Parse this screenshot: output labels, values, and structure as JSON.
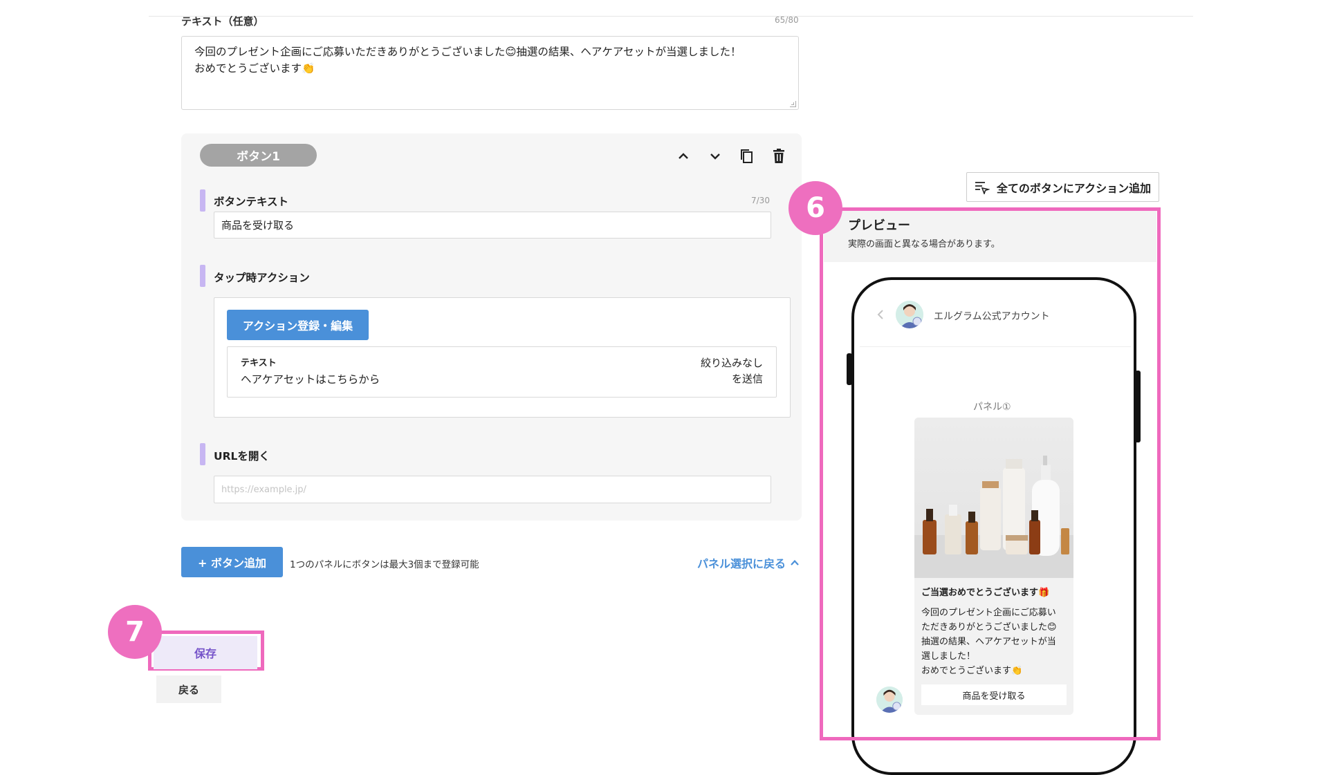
{
  "text_field": {
    "label": "テキスト（任意）",
    "counter": "65/80",
    "lines": [
      "今回のプレゼント企画にご応募いただきありがとうございました😊抽選の結果、ヘアケアセットが当選しました！",
      "おめでとうございます👏"
    ]
  },
  "button_panel": {
    "pill_label": "ボタン1",
    "button_text_label": "ボタンテキスト",
    "button_text_counter": "7/30",
    "button_text_value": "商品を受け取る",
    "tap_action_label": "タップ時アクション",
    "action_edit_label": "アクション登録・編集",
    "action_type": "テキスト",
    "action_value": "ヘアケアセットはこちらから",
    "action_filter_line1": "絞り込みなし",
    "action_filter_line2": "を送信",
    "url_label": "URLを開く",
    "url_placeholder": "https://example.jp/"
  },
  "footer": {
    "add_button_label": "+ ボタン追加",
    "limit_note": "1つのパネルにボタンは最大3個まで登録可能",
    "back_to_panel_label": "パネル選択に戻る",
    "save_label": "保存",
    "back_label": "戻る"
  },
  "badges": {
    "preview": "6",
    "save": "7"
  },
  "preview": {
    "all_action_label": "全てのボタンにアクション追加",
    "title": "プレビュー",
    "subtitle": "実際の画面と異なる場合があります。",
    "account_name": "エルグラム公式アカウント",
    "panel_label": "パネル①",
    "card_title": "ご当選おめでとうございます🎁",
    "card_body": [
      "今回のプレゼント企画にご応募い",
      "ただきありがとうございました😊",
      "抽選の結果、ヘアケアセットが当",
      "選しました！",
      "おめでとうございます👏"
    ],
    "card_button": "商品を受け取る"
  },
  "colors": {
    "accent_blue": "#4a90d9",
    "highlight_pink": "#ef69bd",
    "section_bar": "#c7b6f2",
    "save_text": "#7553c9"
  },
  "icons": [
    "chevron-up-icon",
    "chevron-down-icon",
    "copy-icon",
    "trash-icon",
    "chevron-up-icon",
    "filter-add-icon",
    "chevron-left-icon",
    "avatar-icon",
    "product-image"
  ]
}
